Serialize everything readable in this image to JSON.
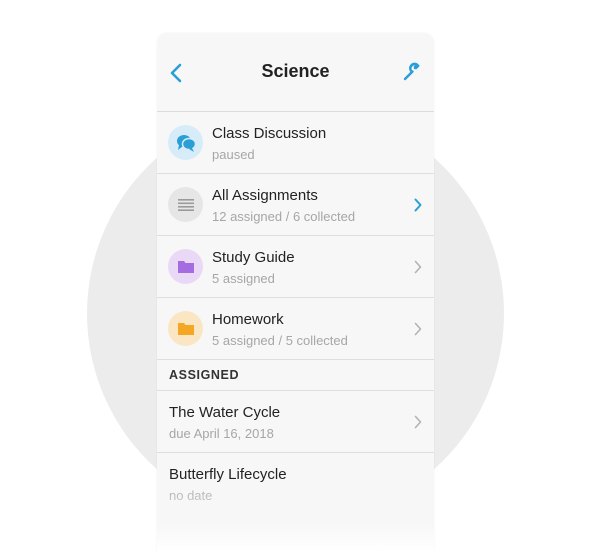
{
  "nav": {
    "title": "Science",
    "back_icon": "chevron-left-icon",
    "settings_icon": "wrench-icon"
  },
  "colors": {
    "accent": "#2a9fd6",
    "discussion": "#2a9fd6",
    "discussion_bg": "#d6ecf8",
    "assignments_bg": "#e6e6e6",
    "study_guide": "#a56be0",
    "study_guide_bg": "#ead9f6",
    "homework": "#f5a623",
    "homework_bg": "#fbe6c4"
  },
  "items": [
    {
      "title": "Class Discussion",
      "subtitle": "paused",
      "icon": "chat-bubbles-icon"
    },
    {
      "title": "All Assignments",
      "subtitle": "12 assigned / 6 collected",
      "icon": "list-lines-icon"
    },
    {
      "title": "Study Guide",
      "subtitle": "5 assigned",
      "icon": "folder-icon"
    },
    {
      "title": "Homework",
      "subtitle": "5 assigned / 5 collected",
      "icon": "folder-icon"
    }
  ],
  "section": {
    "label": "ASSIGNED"
  },
  "assigned": [
    {
      "title": "The Water Cycle",
      "subtitle": "due April 16, 2018"
    },
    {
      "title": "Butterfly Lifecycle",
      "subtitle": "no date"
    }
  ]
}
